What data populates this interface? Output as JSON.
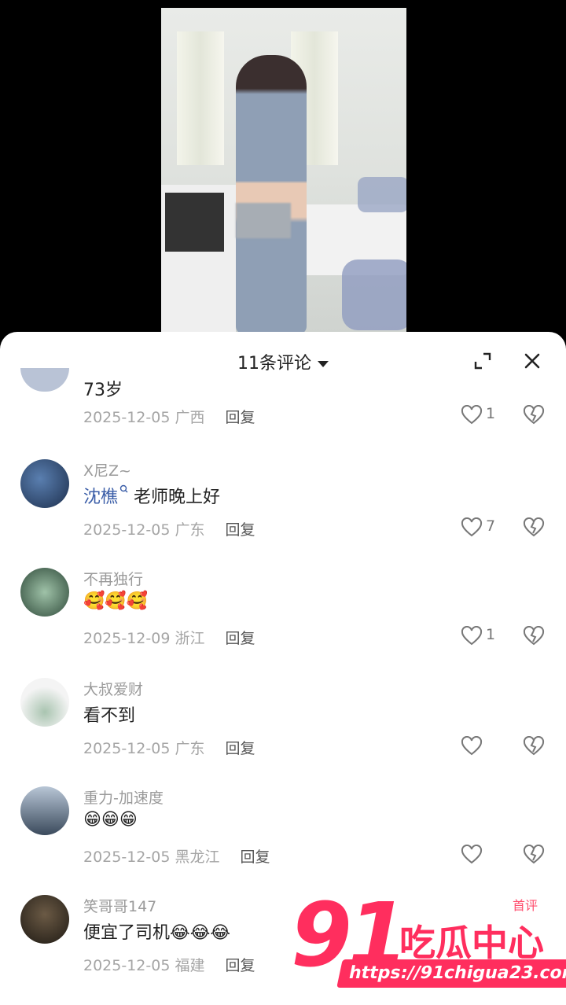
{
  "sheet": {
    "title": "11条评论",
    "partial_top": {
      "text": "73岁",
      "meta": "2025-12-05 广西",
      "reply": "回复",
      "likes": "1"
    },
    "comments": [
      {
        "user": "X尼Z~",
        "mention": "沈樵",
        "text": "老师晚上好",
        "meta": "2025-12-05 广东",
        "reply": "回复",
        "likes": "7"
      },
      {
        "user": "不再独行",
        "text": "🥰🥰🥰",
        "meta": "2025-12-09 浙江",
        "reply": "回复",
        "likes": "1"
      },
      {
        "user": "大叔爱财",
        "text": "看不到",
        "meta": "2025-12-05 广东",
        "reply": "回复",
        "likes": ""
      },
      {
        "user": "重力-加速度",
        "text": "😁😁😁",
        "meta": "2025-12-05 黑龙江",
        "reply": "回复",
        "likes": ""
      },
      {
        "user": "笑哥哥147",
        "badge": "首评",
        "text": "便宜了司机😂😂😂",
        "meta": "2025-12-05 福建",
        "reply": "回复",
        "likes": ""
      }
    ]
  },
  "watermark": {
    "number": "91",
    "title": "吃瓜中心",
    "url": "https://91chigua23.com"
  },
  "colors": {
    "accent": "#ff2e5e",
    "mention": "#3b5ea8",
    "muted": "#a5a5a5"
  },
  "icons": [
    "expand-icon",
    "close-icon",
    "heart-icon",
    "broken-heart-icon",
    "caret-down-icon",
    "search-icon"
  ]
}
